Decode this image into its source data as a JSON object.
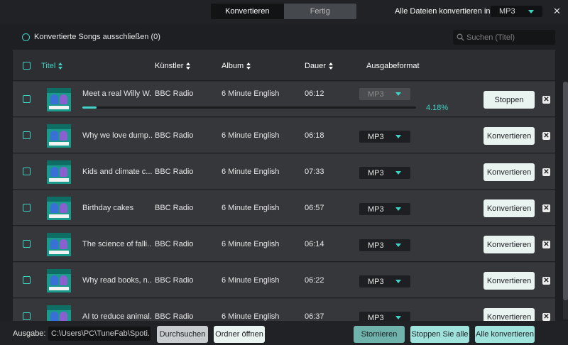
{
  "header": {
    "tabs": [
      {
        "label": "Konvertieren"
      },
      {
        "label": "Fertig"
      }
    ],
    "convert_all_label": "Alle Dateien konvertieren in:",
    "convert_all_format": "MP3",
    "close_glyph": "✕"
  },
  "toolbar": {
    "exclude_label": "Konvertierte Songs ausschließen (0)",
    "search_placeholder": "Suchen (Titel)",
    "search_icon": "search-icon"
  },
  "table": {
    "columns": [
      "Titel",
      "Künstler",
      "Album",
      "Dauer",
      "Ausgabeformat"
    ],
    "rows": [
      {
        "title": "Meet a real Willy W...",
        "artist": "BBC Radio",
        "album": "6 Minute English",
        "duration": "06:12",
        "format": "MP3",
        "action": "Stoppen",
        "progress_percent": 4.18,
        "progress_label": "4.18%"
      },
      {
        "title": "Why we love dump...",
        "artist": "BBC Radio",
        "album": "6 Minute English",
        "duration": "06:18",
        "format": "MP3",
        "action": "Konvertieren"
      },
      {
        "title": "Kids and climate c...",
        "artist": "BBC Radio",
        "album": "6 Minute English",
        "duration": "07:33",
        "format": "MP3",
        "action": "Konvertieren"
      },
      {
        "title": "Birthday cakes",
        "artist": "BBC Radio",
        "album": "6 Minute English",
        "duration": "06:57",
        "format": "MP3",
        "action": "Konvertieren"
      },
      {
        "title": "The science of falli...",
        "artist": "BBC Radio",
        "album": "6 Minute English",
        "duration": "06:14",
        "format": "MP3",
        "action": "Konvertieren"
      },
      {
        "title": "Why read books, n...",
        "artist": "BBC Radio",
        "album": "6 Minute English",
        "duration": "06:22",
        "format": "MP3",
        "action": "Konvertieren"
      },
      {
        "title": "AI to reduce animal...",
        "artist": "BBC Radio",
        "album": "6 Minute English",
        "duration": "06:37",
        "format": "MP3",
        "action": "Konvertieren"
      }
    ],
    "delete_glyph": "✕"
  },
  "footer": {
    "output_label": "Ausgabe:",
    "output_path": "C:\\Users\\PC\\TuneFab\\Spoti...",
    "browse_label": "Durchsuchen",
    "open_folder_label": "Ordner öffnen",
    "cancel_label": "Stornieren",
    "stop_all_label": "Stoppen Sie alle",
    "convert_all_label": "Alle konvertieren"
  },
  "colors": {
    "accent": "#3fd3c5",
    "button_light": "#e9f3ef",
    "button_teal": "#9fe3dc",
    "button_grey": "#c9cccf",
    "button_muted_teal": "#6fb3ac"
  }
}
